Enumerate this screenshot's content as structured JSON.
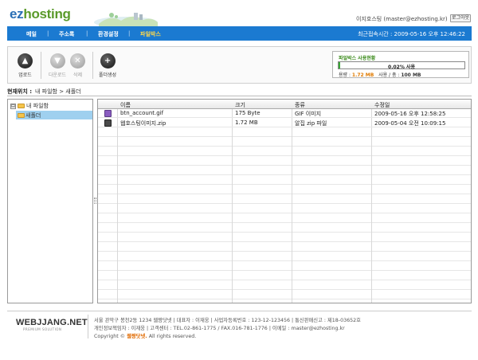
{
  "header": {
    "logo_ez": "ez",
    "logo_hosting": "hosting",
    "user_info": "이지호스팅 (master@ezhosting.kr)",
    "logout_label": "로그아웃"
  },
  "nav": {
    "items": [
      {
        "label": "메일"
      },
      {
        "label": "주소록"
      },
      {
        "label": "환경설정"
      },
      {
        "label": "파일박스"
      }
    ],
    "separator": "|",
    "last_login": "최근접속시간 : 2009-05-16 오후 12:46:22"
  },
  "toolbar": {
    "upload_label": "업로드",
    "download_label": "다운로드",
    "delete_label": "삭제",
    "new_folder_label": "폴더생성"
  },
  "usage": {
    "title": "파일박스 사용현황",
    "percent_text": "0.02% 사용",
    "percent_value": 0.02,
    "used_label": "용량 :",
    "used_value": "1.72 MB",
    "total_label": "사용 / 총 :",
    "total_value": "100 MB"
  },
  "location": {
    "label": "현재위치 :",
    "path": "내 파일함 > 새폴더"
  },
  "tree": {
    "expander": "⊟",
    "root_label": "내 파일함",
    "child_label": "새폴더"
  },
  "table": {
    "columns": [
      "이름",
      "크기",
      "종류",
      "수정일"
    ],
    "rows": [
      {
        "name": "btn_account.gif",
        "size": "175 Byte",
        "type": "GIF 이미지",
        "modified": "2009-05-16 오후 12:58:25",
        "icon": "gif-file-icon"
      },
      {
        "name": "웹호스팅이미지.zip",
        "size": "1.72 MB",
        "type": "알집 zip 파일",
        "modified": "2009-05-04 오전 10:09:15",
        "icon": "zip-file-icon"
      }
    ]
  },
  "footer": {
    "logo": "WEBJJANG.NET",
    "logo_sub": "PREMIUM SOLUTION",
    "line1": "서울 관악구 봉천2동 1234   웹짱닷넷   |   대표자 : 이재웅   |   사업자등록번호 : 123-12-123456   |   통신판매신고 : 제18-03652호",
    "line2": "개인정보책임자 : 이재웅   |   고객센터 : TEL.02-861-1775 / FAX.016-781-1776   |   이메일 : master@ezhosting.kr",
    "copyright_prefix": "Copyright ©",
    "copyright_brand": "웹짱닷넷.",
    "copyright_suffix": "All rights reserved."
  },
  "colors": {
    "nav_bg": "#1b7ad1",
    "nav_active": "#ffd84a",
    "usage_fill": "#3aa838",
    "selected_row": "#9fd0ef"
  }
}
